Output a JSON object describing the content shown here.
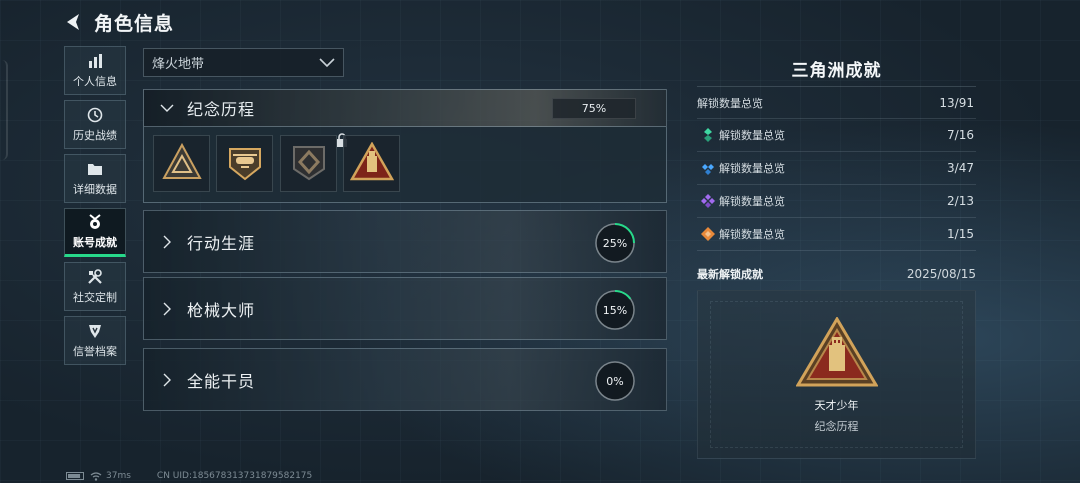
{
  "header": {
    "title": "角色信息"
  },
  "sidebar": {
    "items": [
      {
        "label": "个人信息",
        "icon": "bar-chart-icon",
        "active": false
      },
      {
        "label": "历史战绩",
        "icon": "clock-icon",
        "active": false
      },
      {
        "label": "详细数据",
        "icon": "folder-icon",
        "active": false
      },
      {
        "label": "账号成就",
        "icon": "medal-icon",
        "active": true
      },
      {
        "label": "社交定制",
        "icon": "tools-icon",
        "active": false
      },
      {
        "label": "信誉档案",
        "icon": "shield-icon",
        "active": false
      }
    ]
  },
  "filter": {
    "selected": "烽火地带"
  },
  "categories": [
    {
      "title": "纪念历程",
      "progress_text": "75%",
      "progress": 0.75,
      "expanded": true
    },
    {
      "title": "行动生涯",
      "progress_text": "25%",
      "progress": 0.25
    },
    {
      "title": "枪械大师",
      "progress_text": "15%",
      "progress": 0.15
    },
    {
      "title": "全能干员",
      "progress_text": "0%",
      "progress": 0.0
    }
  ],
  "badges": [
    {
      "icon": "triangle-badge-icon",
      "locked": false
    },
    {
      "icon": "helicopter-badge-icon",
      "locked": false
    },
    {
      "icon": "diamond-shield-badge-icon",
      "locked": true
    },
    {
      "icon": "usb-drive-badge-icon",
      "locked": false
    }
  ],
  "summary": {
    "title": "三角洲成就",
    "total": {
      "label": "解锁数量总览",
      "count": "13/91"
    },
    "tiers": [
      {
        "label": "解锁数量总览",
        "count": "7/16",
        "icon": "green-gem-icon",
        "color": "#3fd8a2"
      },
      {
        "label": "解锁数量总览",
        "count": "3/47",
        "icon": "blue-gem-icon",
        "color": "#4aa8ff"
      },
      {
        "label": "解锁数量总览",
        "count": "2/13",
        "icon": "purple-gem-icon",
        "color": "#a26bf0"
      },
      {
        "label": "解锁数量总览",
        "count": "1/15",
        "icon": "orange-gem-icon",
        "color": "#e8893a"
      }
    ]
  },
  "latest": {
    "label": "最新解锁成就",
    "date": "2025/08/15",
    "name": "天才少年",
    "category": "纪念历程",
    "icon": "usb-drive-badge-icon"
  },
  "footer": {
    "ping": "37ms",
    "uid": "CN UID:18567831373187958217​5"
  },
  "colors": {
    "accent": "#27d98a",
    "badge_gold": "#d2a35a",
    "badge_red": "#8b2a1e"
  }
}
